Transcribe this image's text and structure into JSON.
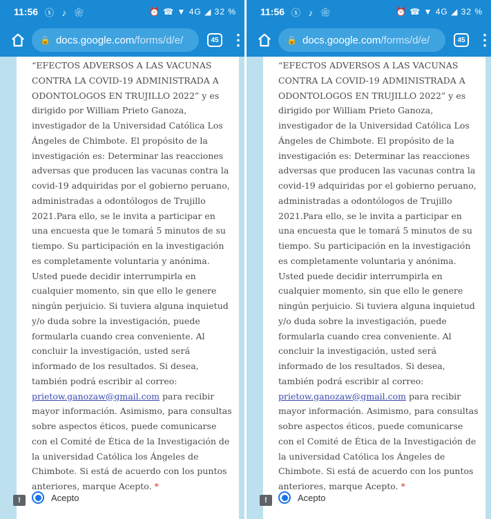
{
  "status_bar": {
    "time": "11:56",
    "app_icons": "ⓢ ♪ ❀",
    "system_icons": "⏰ ☎ ▼ 4G ◢ 32 %"
  },
  "browser": {
    "url_domain": "docs.google.com",
    "url_path": "/forms/d/e/",
    "tab_count": "45"
  },
  "form": {
    "text_intro": "“EFECTOS ADVERSOS A LAS VACUNAS CONTRA LA COVID-19 ADMINISTRADA A ODONTOLOGOS EN TRUJILLO 2022” y es dirigido por William Prieto Ganoza, investigador de la Universidad Católica Los Ángeles de Chimbote. El propósito de la investigación es: Determinar las reacciones adversas que producen las vacunas contra la covid-19 adquiridas por el gobierno peruano, administradas a odontólogos de Trujillo 2021.Para ello, se le invita a participar en una encuesta que le tomará 5 minutos de su tiempo. Su participación en la investigación es completamente voluntaria y anónima. Usted puede decidir interrumpirla en cualquier momento, sin que ello le genere ningún perjuicio. Si tuviera alguna inquietud y/o duda sobre la investigación, puede formularla cuando crea conveniente. Al concluir la investigación, usted será informado de los resultados. Si desea, también podrá escribir al correo:",
    "email": "prietow.ganozaw@gmail.com",
    "text_outro": "para recibir mayor información. Asimismo, para consultas sobre aspectos éticos, puede comunicarse con el Comité de Ética de la Investigación de la universidad Católica los Ángeles de Chimbote. Si está de acuerdo con los puntos anteriores, marque Acepto.",
    "required_mark": "*",
    "option_label": "Acepto",
    "report_icon": "!"
  },
  "colors": {
    "toolbar": "#1a8ad4",
    "page_background": "#bde0ef",
    "radio_accent": "#1a73e8",
    "required": "#d93025"
  }
}
